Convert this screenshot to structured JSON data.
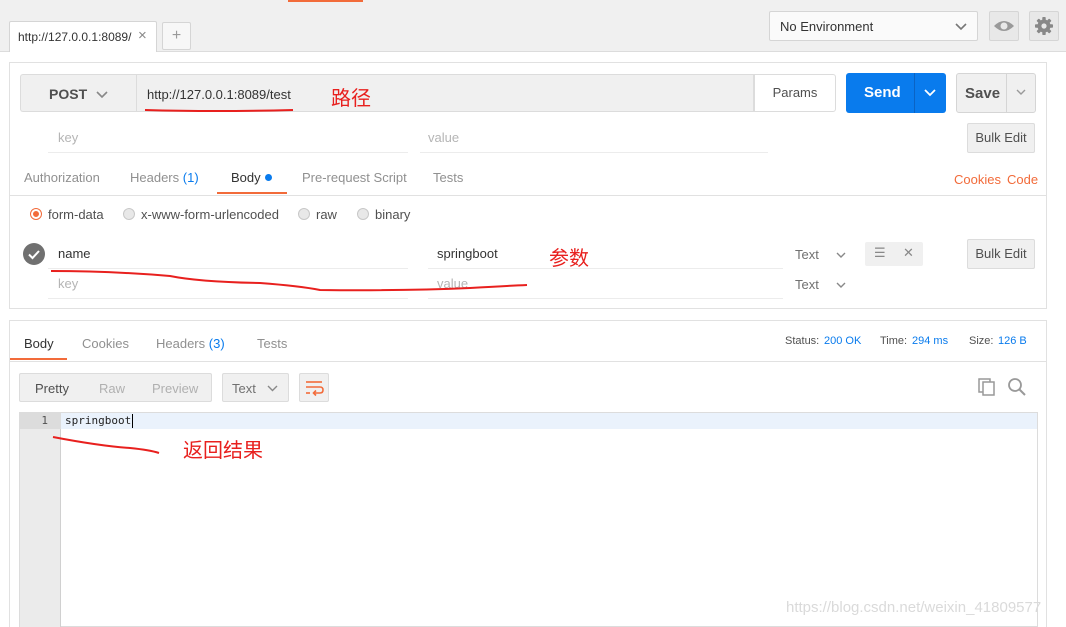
{
  "tab": {
    "title": "http://127.0.0.1:8089/",
    "close": "×",
    "new": "+"
  },
  "environment": {
    "selected": "No Environment"
  },
  "request": {
    "method": "POST",
    "url": "http://127.0.0.1:8089/test",
    "params_label": "Params",
    "send_label": "Send",
    "save_label": "Save",
    "params_row": {
      "key_placeholder": "key",
      "value_placeholder": "value",
      "bulk_edit": "Bulk Edit"
    },
    "tabs": [
      "Authorization",
      "Headers",
      "Body",
      "Pre-request Script",
      "Tests"
    ],
    "headers_count": "(1)",
    "links": {
      "cookies": "Cookies",
      "code": "Code"
    },
    "body_modes": [
      "form-data",
      "x-www-form-urlencoded",
      "raw",
      "binary"
    ],
    "selected_body_mode": "form-data",
    "form_rows": [
      {
        "key": "name",
        "value": "springboot",
        "type": "Text"
      }
    ],
    "new_row": {
      "key_placeholder": "key",
      "value_placeholder": "value",
      "type": "Text"
    },
    "body_bulk_edit": "Bulk Edit",
    "row_menu": "☰",
    "row_delete": "✕"
  },
  "response": {
    "tabs": [
      "Body",
      "Cookies",
      "Headers",
      "Tests"
    ],
    "headers_count": "(3)",
    "status_label": "Status:",
    "status_value": "200 OK",
    "time_label": "Time:",
    "time_value": "294 ms",
    "size_label": "Size:",
    "size_value": "126 B",
    "view_modes": [
      "Pretty",
      "Raw",
      "Preview"
    ],
    "format": "Text",
    "lines": [
      {
        "num": "1",
        "text": "springboot"
      }
    ]
  },
  "annotations": {
    "path": "路径",
    "params": "参数",
    "result": "返回结果"
  },
  "watermark": "https://blog.csdn.net/weixin_41809577",
  "colors": {
    "accent": "#f26b3a",
    "primary": "#097bed",
    "annotation": "#e8201e"
  }
}
